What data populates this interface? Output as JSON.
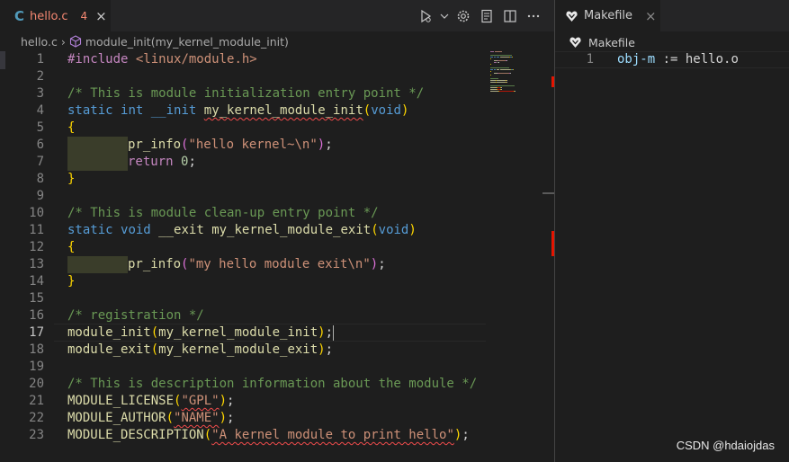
{
  "left_tab": {
    "icon_letter": "C",
    "filename": "hello.c",
    "problem_count": "4",
    "close_glyph": "×"
  },
  "right_tab": {
    "filename": "Makefile",
    "close_glyph": "×"
  },
  "breadcrumb": {
    "file": "hello.c",
    "separator": "›",
    "symbol": "module_init(my_kernel_module_init)"
  },
  "right_breadcrumb": {
    "file": "Makefile"
  },
  "editor_actions": [
    "run-icon",
    "chevron-down-icon",
    "settings-icon",
    "preview-icon",
    "split-editor-icon",
    "more-actions-icon"
  ],
  "cursor_line": "17",
  "code_lines": [
    {
      "n": "1",
      "segments": [
        {
          "t": "#include",
          "c": "pp"
        },
        {
          "t": " ",
          "c": "plain"
        },
        {
          "t": "<linux/module.h>",
          "c": "inc"
        }
      ]
    },
    {
      "n": "2",
      "segments": []
    },
    {
      "n": "3",
      "segments": [
        {
          "t": "/* This is module initialization entry point */",
          "c": "cm"
        }
      ]
    },
    {
      "n": "4",
      "segments": [
        {
          "t": "static",
          "c": "kw"
        },
        {
          "t": " ",
          "c": "plain"
        },
        {
          "t": "int",
          "c": "kw"
        },
        {
          "t": " ",
          "c": "plain"
        },
        {
          "t": "__init",
          "c": "kw"
        },
        {
          "t": " ",
          "c": "plain"
        },
        {
          "t": "my_kernel_module_init",
          "c": "fn squig"
        },
        {
          "t": "(",
          "c": "br1"
        },
        {
          "t": "void",
          "c": "kw"
        },
        {
          "t": ")",
          "c": "br1"
        }
      ]
    },
    {
      "n": "5",
      "segments": [
        {
          "t": "{",
          "c": "br1"
        }
      ]
    },
    {
      "n": "6",
      "segments": [
        {
          "t": "",
          "c": "indent"
        },
        {
          "t": "pr_info",
          "c": "fn"
        },
        {
          "t": "(",
          "c": "br2"
        },
        {
          "t": "\"hello kernel~\\n\"",
          "c": "str"
        },
        {
          "t": ")",
          "c": "br2"
        },
        {
          "t": ";",
          "c": "plain"
        }
      ]
    },
    {
      "n": "7",
      "segments": [
        {
          "t": "",
          "c": "indent"
        },
        {
          "t": "return",
          "c": "pp"
        },
        {
          "t": " ",
          "c": "plain"
        },
        {
          "t": "0",
          "c": "num"
        },
        {
          "t": ";",
          "c": "plain"
        }
      ]
    },
    {
      "n": "8",
      "segments": [
        {
          "t": "}",
          "c": "br1"
        }
      ]
    },
    {
      "n": "9",
      "segments": []
    },
    {
      "n": "10",
      "segments": [
        {
          "t": "/* This is module clean-up entry point */",
          "c": "cm"
        }
      ]
    },
    {
      "n": "11",
      "segments": [
        {
          "t": "static",
          "c": "kw"
        },
        {
          "t": " ",
          "c": "plain"
        },
        {
          "t": "void",
          "c": "kw"
        },
        {
          "t": " ",
          "c": "plain"
        },
        {
          "t": "__exit",
          "c": "fn"
        },
        {
          "t": " ",
          "c": "plain"
        },
        {
          "t": "my_kernel_module_exit",
          "c": "fn"
        },
        {
          "t": "(",
          "c": "br1"
        },
        {
          "t": "void",
          "c": "kw"
        },
        {
          "t": ")",
          "c": "br1"
        }
      ]
    },
    {
      "n": "12",
      "segments": [
        {
          "t": "{",
          "c": "br1"
        }
      ]
    },
    {
      "n": "13",
      "segments": [
        {
          "t": "",
          "c": "indent"
        },
        {
          "t": "pr_info",
          "c": "fn"
        },
        {
          "t": "(",
          "c": "br2"
        },
        {
          "t": "\"my hello module exit\\n\"",
          "c": "str"
        },
        {
          "t": ")",
          "c": "br2"
        },
        {
          "t": ";",
          "c": "plain"
        }
      ]
    },
    {
      "n": "14",
      "segments": [
        {
          "t": "}",
          "c": "br1"
        }
      ]
    },
    {
      "n": "15",
      "segments": []
    },
    {
      "n": "16",
      "segments": [
        {
          "t": "/* registration */",
          "c": "cm"
        }
      ]
    },
    {
      "n": "17",
      "segments": [
        {
          "t": "module_init",
          "c": "fn"
        },
        {
          "t": "(",
          "c": "br1"
        },
        {
          "t": "my_kernel_module_init",
          "c": "fn"
        },
        {
          "t": ")",
          "c": "br1"
        },
        {
          "t": ";",
          "c": "plain"
        },
        {
          "t": "",
          "c": "cursor"
        }
      ]
    },
    {
      "n": "18",
      "segments": [
        {
          "t": "module_exit",
          "c": "fn"
        },
        {
          "t": "(",
          "c": "br1"
        },
        {
          "t": "my_kernel_module_exit",
          "c": "fn"
        },
        {
          "t": ")",
          "c": "br1"
        },
        {
          "t": ";",
          "c": "plain"
        }
      ]
    },
    {
      "n": "19",
      "segments": []
    },
    {
      "n": "20",
      "segments": [
        {
          "t": "/* This is description information about the module */",
          "c": "cm"
        }
      ]
    },
    {
      "n": "21",
      "segments": [
        {
          "t": "MODULE_LICENSE",
          "c": "fn"
        },
        {
          "t": "(",
          "c": "br1"
        },
        {
          "t": "\"GPL\"",
          "c": "str squig"
        },
        {
          "t": ")",
          "c": "br1"
        },
        {
          "t": ";",
          "c": "plain"
        }
      ]
    },
    {
      "n": "22",
      "segments": [
        {
          "t": "MODULE_AUTHOR",
          "c": "fn"
        },
        {
          "t": "(",
          "c": "br1"
        },
        {
          "t": "\"NAME\"",
          "c": "str squig"
        },
        {
          "t": ")",
          "c": "br1"
        },
        {
          "t": ";",
          "c": "plain"
        }
      ]
    },
    {
      "n": "23",
      "segments": [
        {
          "t": "MODULE_DESCRIPTION",
          "c": "fn"
        },
        {
          "t": "(",
          "c": "br1"
        },
        {
          "t": "\"A kernel module to print hello\"",
          "c": "str squig"
        },
        {
          "t": ")",
          "c": "br1"
        },
        {
          "t": ";",
          "c": "plain"
        }
      ]
    }
  ],
  "makefile_lines": [
    {
      "n": "1",
      "segments": [
        {
          "t": "obj-m",
          "c": "var"
        },
        {
          "t": " := hello.o",
          "c": "plain"
        }
      ]
    }
  ],
  "watermark": "CSDN @hdaiojdas",
  "colors": {
    "error": "#e51400",
    "background": "#1e1e1e",
    "tab_bar": "#252526"
  }
}
